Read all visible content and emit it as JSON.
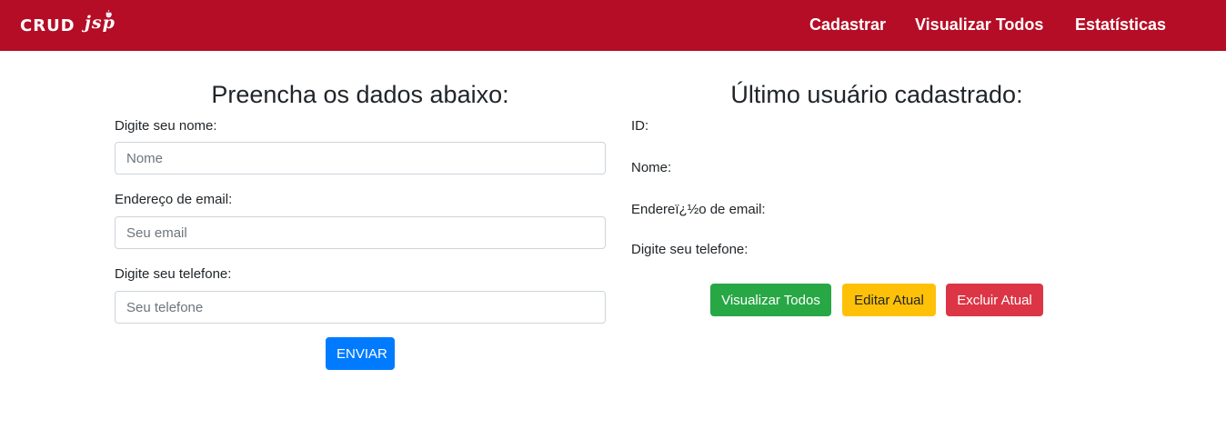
{
  "brand": {
    "logo_text": "CRUD",
    "logo_suffix": "jsp"
  },
  "nav": {
    "items": [
      {
        "label": "Cadastrar"
      },
      {
        "label": "Visualizar Todos"
      },
      {
        "label": "Estatísticas"
      }
    ]
  },
  "form": {
    "title": "Preencha os dados abaixo:",
    "name_label": "Digite seu nome:",
    "name_placeholder": "Nome",
    "email_label": "Endereço de email:",
    "email_placeholder": "Seu email",
    "phone_label": "Digite seu telefone:",
    "phone_placeholder": "Seu telefone",
    "submit_label": "ENVIAR"
  },
  "last_user": {
    "title": "Último usuário cadastrado:",
    "id_label": "ID:",
    "name_label": "Nome:",
    "email_label": "Endereï¿½o de email:",
    "phone_label": "Digite seu telefone:",
    "view_all_label": "Visualizar Todos",
    "edit_label": "Editar Atual",
    "delete_label": "Excluir Atual"
  },
  "colors": {
    "navbar": "#b50d26",
    "primary": "#007bff",
    "success": "#28a745",
    "warning": "#ffc107",
    "danger": "#dc3545"
  }
}
